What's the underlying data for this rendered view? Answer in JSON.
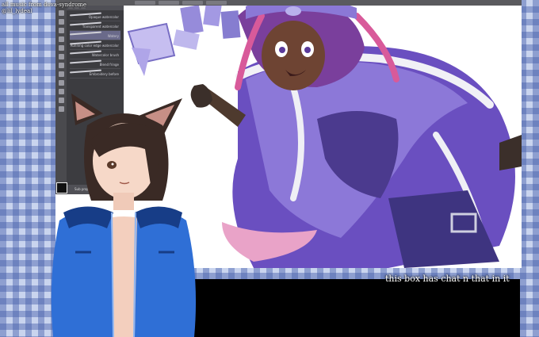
{
  "credits": {
    "line1": "all music from dova-syndrome",
    "line2": "@lil_lydeal"
  },
  "chat_box": {
    "caption": "this box has chat n that in it"
  },
  "canvas_window": {
    "tabs": [
      "",
      "",
      "",
      ""
    ]
  },
  "brush_panel": {
    "tabs": [
      "",
      "",
      ""
    ],
    "brushes": [
      {
        "label": "Opaque watercolor"
      },
      {
        "label": "Transparent watercolor"
      },
      {
        "label": "Watery"
      },
      {
        "label": "Running color edge watercolor"
      },
      {
        "label": "Watercolor brush"
      },
      {
        "label": "Blend fringe"
      },
      {
        "label": "Embroidery before"
      }
    ],
    "footer": "Sub property"
  },
  "colors": {
    "background_light": "#c9d4ee",
    "background_dark": "#4e6bb5",
    "vest_blue": "#2f6fd6",
    "hair_dark": "#3a2a25",
    "cape_purple": "#6a4fc0",
    "hair_pink": "#d85a9a"
  }
}
